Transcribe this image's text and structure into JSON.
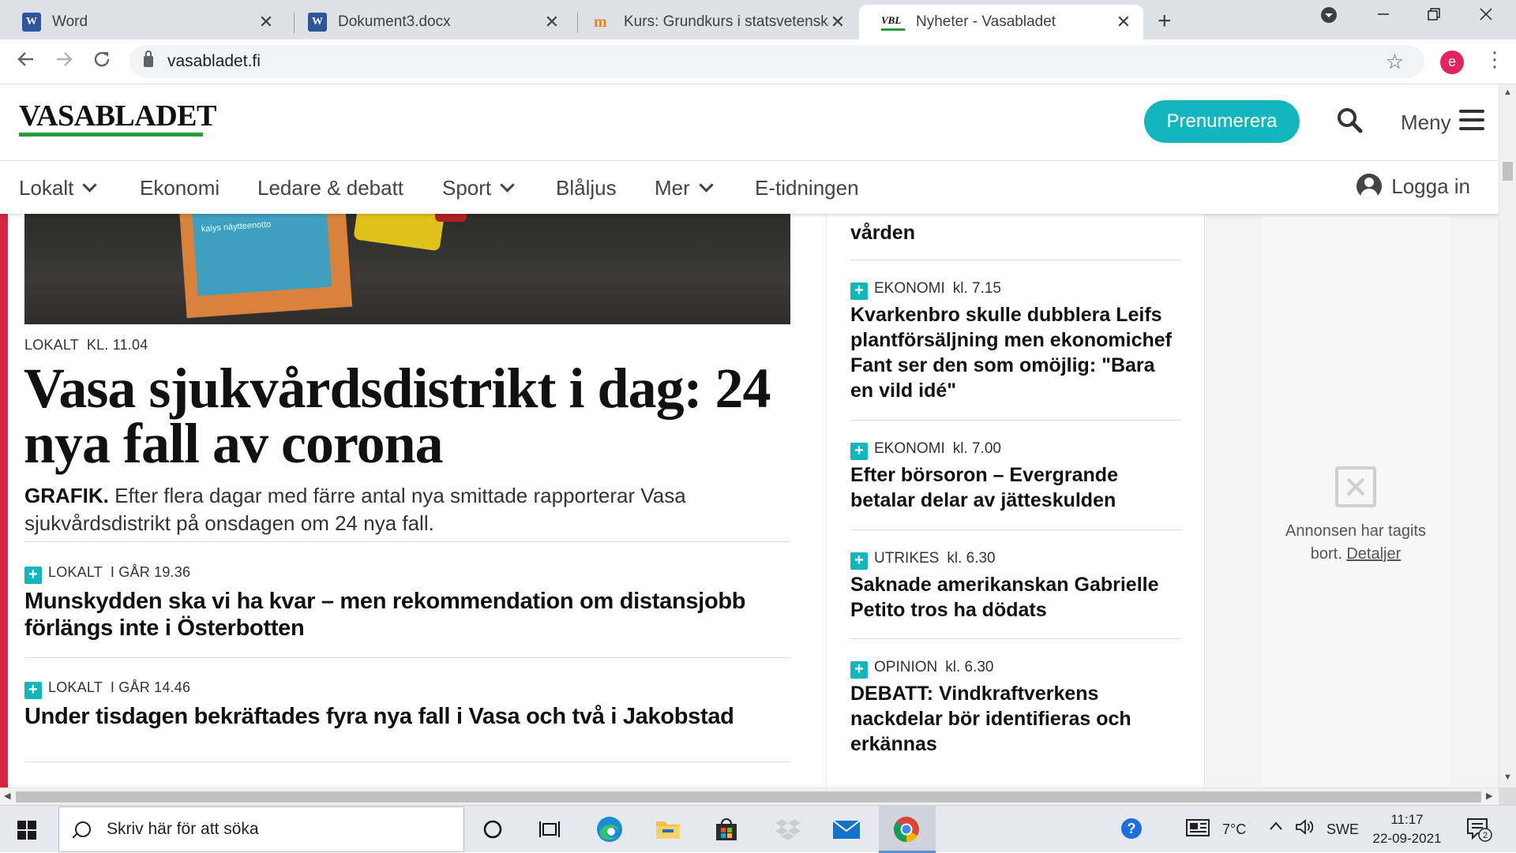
{
  "browser": {
    "tabs": [
      {
        "label": "Word",
        "favicon": "word-icon"
      },
      {
        "label": "Dokument3.docx",
        "favicon": "word-icon"
      },
      {
        "label": "Kurs: Grundkurs i statsvetenskap",
        "favicon": "moodle-icon"
      },
      {
        "label": "Nyheter - Vasabladet",
        "favicon": "vbl-icon"
      }
    ],
    "close_glyph": "✕",
    "new_tab_glyph": "+",
    "url": "vasabladet.fi",
    "profile_initial": "e",
    "favicon_word_letter": "W",
    "favicon_vbl_text": "VBL"
  },
  "site": {
    "logo": "VASABLADET",
    "subscribe_label": "Prenumerera",
    "menu_label": "Meny",
    "login_label": "Logga in",
    "nav": [
      {
        "label": "Lokalt",
        "dropdown": true
      },
      {
        "label": "Ekonomi",
        "dropdown": false
      },
      {
        "label": "Ledare & debatt",
        "dropdown": false
      },
      {
        "label": "Sport",
        "dropdown": true
      },
      {
        "label": "Blåljus",
        "dropdown": false
      },
      {
        "label": "Mer",
        "dropdown": true
      },
      {
        "label": "E-tidningen",
        "dropdown": false
      }
    ],
    "colors": {
      "brand_green": "#2a9b3a",
      "accent_teal": "#14b6bd",
      "section_red": "#d7253f"
    }
  },
  "main": {
    "hero_sign_text": "kalys näytteenotto",
    "lead_story": {
      "section": "LOKALT",
      "time": "KL. 11.04",
      "title": "Vasa sjukvårdsdistrikt i dag: 24 nya fall av corona",
      "lead_prefix": "GRAFIK.",
      "lead": " Efter flera dagar med färre antal nya smittade rapporterar Vasa sjukvårdsdistrikt på onsdagen om 24 nya fall."
    },
    "stories": [
      {
        "section": "LOKALT",
        "time": "I GÅR 19.36",
        "title": "Munskydden ska vi ha kvar – men rekommendation om distansjobb förlängs inte i Österbotten"
      },
      {
        "section": "LOKALT",
        "time": "I GÅR 14.46",
        "title": "Under tisdagen bekräftades fyra nya fall i Vasa och två i Jakobstad"
      }
    ]
  },
  "sidebar": {
    "cut_title": "vården",
    "items": [
      {
        "section": "EKONOMI",
        "time": "kl. 7.15",
        "title": "Kvarkenbro skulle dubblera Leifs plantförsäljning men ekonomichef Fant ser den som omöjlig: \"Bara en vild idé\""
      },
      {
        "section": "EKONOMI",
        "time": "kl. 7.00",
        "title": "Efter börsoron – Evergrande betalar delar av jätteskulden"
      },
      {
        "section": "UTRIKES",
        "time": "kl. 6.30",
        "title": "Saknade amerikanskan Gabrielle Petito tros ha dödats"
      },
      {
        "section": "OPINION",
        "time": "kl. 6.30",
        "title": "DEBATT: Vindkraftverkens nackdelar bör identifieras och erkännas"
      }
    ]
  },
  "ad": {
    "text": "Annonsen har tagits bort.",
    "link": "Detaljer"
  },
  "taskbar": {
    "search_placeholder": "Skriv här för att söka",
    "temperature": "7°C",
    "language": "SWE",
    "time": "11:17",
    "date": "22-09-2021",
    "notification_count": "2",
    "help_glyph": "?"
  }
}
